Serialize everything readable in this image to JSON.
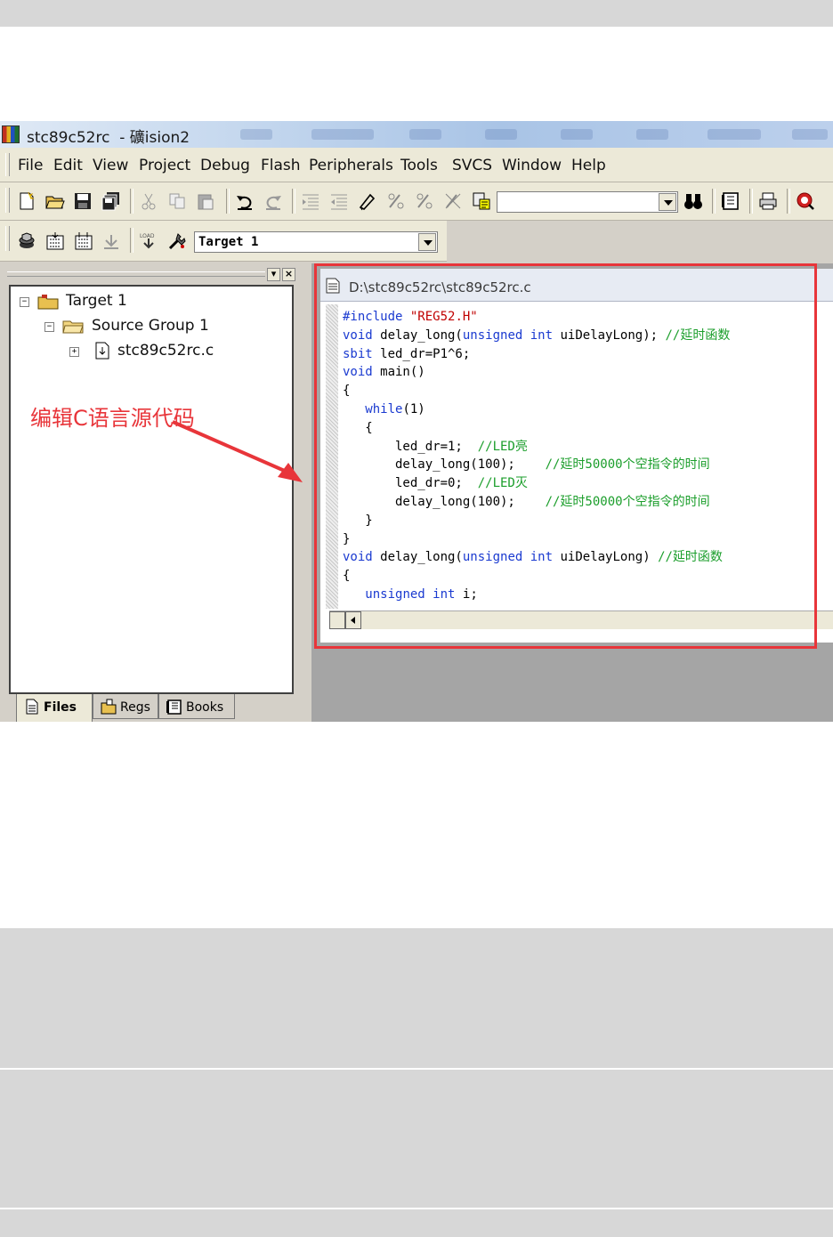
{
  "window": {
    "title": "stc89c52rc  - 礦ision2"
  },
  "menu": [
    "File",
    "Edit",
    "View",
    "Project",
    "Debug",
    "Flash",
    "Peripherals",
    "Tools",
    "SVCS",
    "Window",
    "Help"
  ],
  "build_toolbar": {
    "target_select": "Target 1"
  },
  "project_tree": {
    "target": "Target 1",
    "group": "Source Group 1",
    "file": "stc89c52rc.c",
    "annotation": "编辑C语言源代码"
  },
  "tabs": [
    "Files",
    "Regs",
    "Books"
  ],
  "editor": {
    "path": "D:\\stc89c52rc\\stc89c52rc.c",
    "lines": [
      "#include \"REG52.H\"",
      "void delay_long(unsigned int uiDelayLong); //延时函数",
      "sbit led_dr=P1^6;",
      "void main()",
      "{",
      "   while(1)",
      "   {",
      "       led_dr=1;  //LED亮",
      "       delay_long(100);    //延时50000个空指令的时间",
      "       led_dr=0;  //LED灭",
      "       delay_long(100);    //延时50000个空指令的时间",
      "   }",
      "}",
      "void delay_long(unsigned int uiDelayLong) //延时函数",
      "{",
      "   unsigned int i;"
    ]
  },
  "colors": {
    "highlight_box": "#e8353a",
    "keyword": "#1a3ad0",
    "comment": "#1b9e2b",
    "string": "#c00000"
  }
}
